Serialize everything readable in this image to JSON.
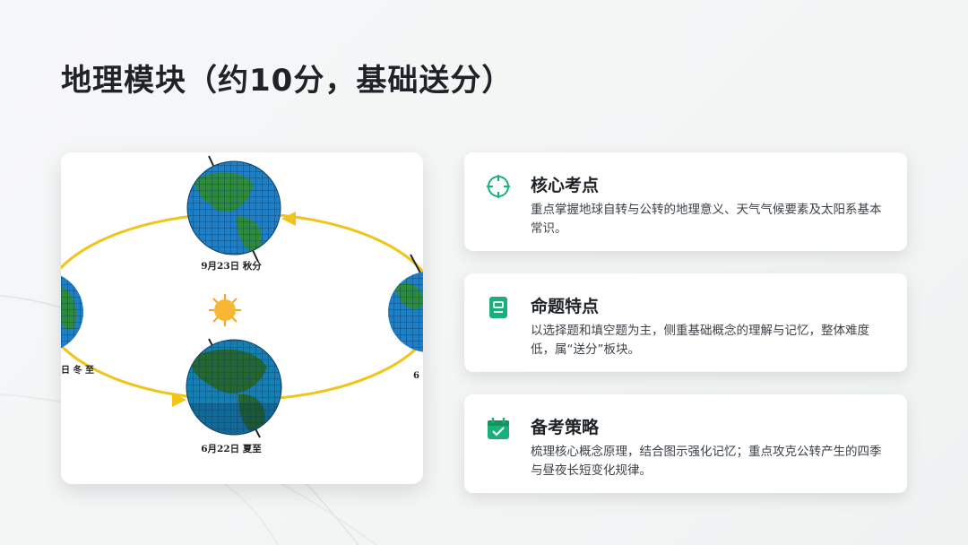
{
  "slide": {
    "title": "地理模块（约10分，基础送分）"
  },
  "diagram": {
    "labels": {
      "autumn": "9月23日 秋分",
      "summer": "6月22日 夏至",
      "winter_fragment": "日 冬 至",
      "right_fragment": "6"
    }
  },
  "cards": [
    {
      "icon": "crosshair-icon",
      "title": "核心考点",
      "text": "重点掌握地球自转与公转的地理意义、天气气候要素及太阳系基本常识。"
    },
    {
      "icon": "document-icon",
      "title": "命题特点",
      "text": "以选择题和填空题为主，侧重基础概念的理解与记忆，整体难度低，属“送分”板块。"
    },
    {
      "icon": "calendar-check-icon",
      "title": "备考策略",
      "text": "梳理核心概念原理，结合图示强化记忆；重点攻克公转产生的四季与昼夜长短变化规律。"
    }
  ],
  "colors": {
    "accent": "#1ab07a",
    "title": "#1f2328",
    "body_text": "#3d4248",
    "orbit": "#f0c419",
    "ocean": "#1f7fc4",
    "land": "#2e8b3a",
    "sun": "#f6a623"
  }
}
